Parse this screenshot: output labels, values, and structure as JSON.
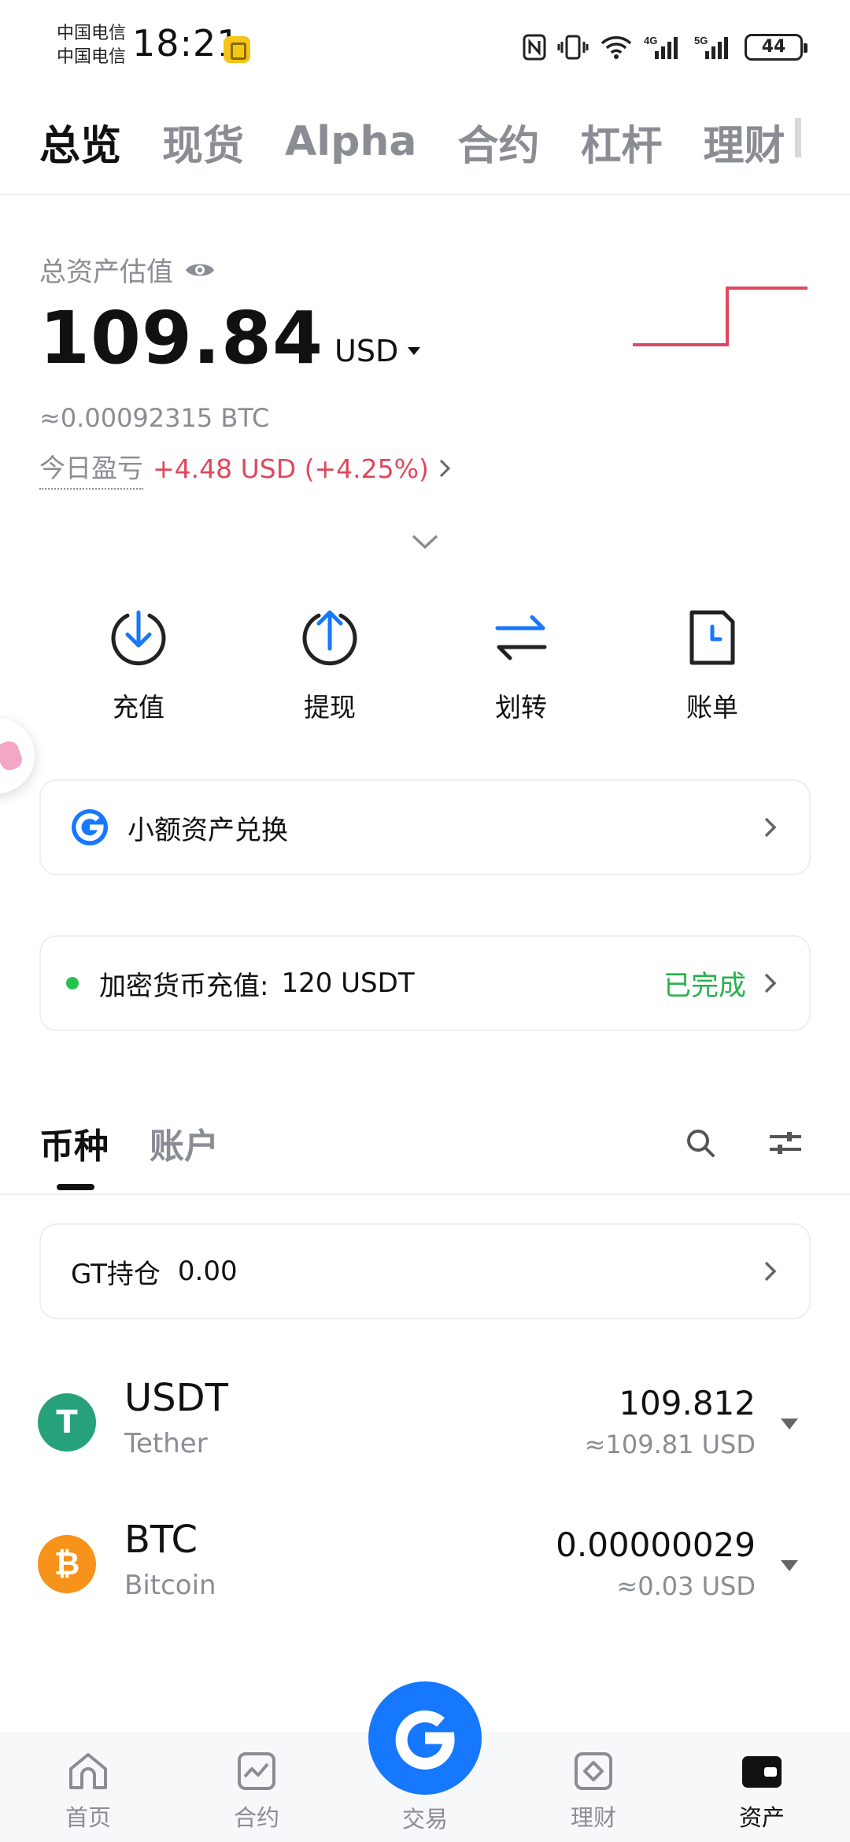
{
  "status_bar": {
    "carrier_1": "中国电信",
    "carrier_2": "中国电信",
    "time": "18:21",
    "network_1": "4G",
    "network_2": "5G",
    "battery": "44"
  },
  "top_tabs": [
    "总览",
    "现货",
    "Alpha",
    "合约",
    "杠杆",
    "理财"
  ],
  "summary": {
    "label": "总资产估值",
    "value": "109.84",
    "currency": "USD",
    "btc_equiv": "≈0.00092315 BTC",
    "pnl_label": "今日盈亏",
    "pnl_value": "+4.48 USD (+4.25%)",
    "pnl_color": "#e0485e"
  },
  "actions": [
    {
      "label": "充值",
      "icon": "deposit-icon"
    },
    {
      "label": "提现",
      "icon": "withdraw-icon"
    },
    {
      "label": "划转",
      "icon": "transfer-icon"
    },
    {
      "label": "账单",
      "icon": "bill-icon"
    }
  ],
  "small_exchange": {
    "label": "小额资产兑换"
  },
  "deposit_status": {
    "label": "加密货币充值:",
    "amount": "120 USDT",
    "status": "已完成",
    "status_color": "#27b24c"
  },
  "asset_tabs": [
    "币种",
    "账户"
  ],
  "gt_holding": {
    "label": "GT持仓",
    "value": "0.00"
  },
  "coins": [
    {
      "symbol": "USDT",
      "name": "Tether",
      "amount": "109.812",
      "usd": "≈109.81 USD",
      "color": "#26a17b",
      "glyph": "T"
    },
    {
      "symbol": "BTC",
      "name": "Bitcoin",
      "amount": "0.00000029",
      "usd": "≈0.03 USD",
      "color": "#f7931a",
      "glyph": "₿"
    }
  ],
  "bottom_nav": [
    {
      "label": "首页",
      "icon": "home-icon"
    },
    {
      "label": "合约",
      "icon": "futures-icon"
    },
    {
      "label": "交易",
      "icon": "trade-icon"
    },
    {
      "label": "理财",
      "icon": "earn-icon"
    },
    {
      "label": "资产",
      "icon": "wallet-icon",
      "active": true
    }
  ],
  "accent_color": "#1677ff"
}
